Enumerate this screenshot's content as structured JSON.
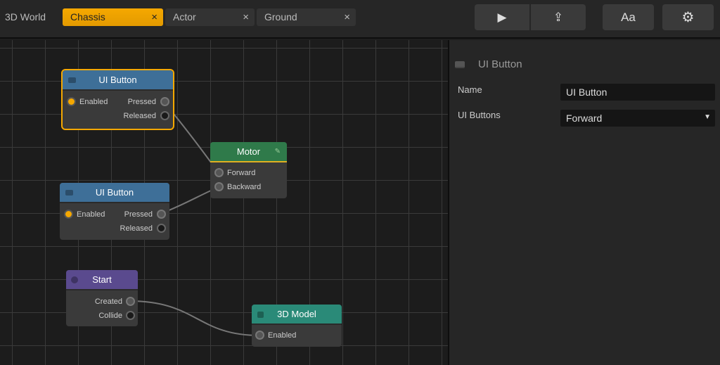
{
  "topbar": {
    "world_label": "3D World",
    "tabs": [
      {
        "label": "Chassis",
        "active": true
      },
      {
        "label": "Actor",
        "active": false
      },
      {
        "label": "Ground",
        "active": false
      }
    ],
    "close_glyph": "×",
    "buttons": {
      "play": "▶",
      "share": "⇪",
      "font": "Aa",
      "settings": "⚙"
    }
  },
  "nodes": {
    "button1": {
      "title": "UI Button",
      "in": "Enabled",
      "out1": "Pressed",
      "out2": "Released",
      "color": "#3e6f98"
    },
    "motor": {
      "title": "Motor",
      "in1": "Forward",
      "in2": "Backward",
      "color": "#2f7a4a"
    },
    "button2": {
      "title": "UI Button",
      "in": "Enabled",
      "out1": "Pressed",
      "out2": "Released",
      "color": "#3e6f98"
    },
    "start": {
      "title": "Start",
      "out1": "Created",
      "out2": "Collide",
      "color": "#5a4a8e"
    },
    "model": {
      "title": "3D Model",
      "in": "Enabled",
      "color": "#2a8a78"
    }
  },
  "inspector": {
    "title": "UI Button",
    "name_label": "Name",
    "name_value": "UI Button",
    "buttons_label": "UI Buttons",
    "buttons_value": "Forward"
  }
}
